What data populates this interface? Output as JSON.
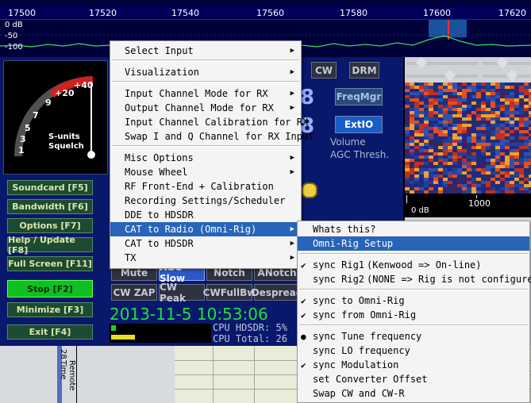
{
  "spectrum": {
    "freq_labels": [
      "17500",
      "17520",
      "17540",
      "17560",
      "17580",
      "17600",
      "17620"
    ],
    "db_labels": [
      "0 dB",
      "-50",
      "-100"
    ]
  },
  "smeter": {
    "scale_labels": [
      "+40",
      "+20",
      "9",
      "7",
      "5",
      "3",
      "1"
    ],
    "caption1": "S-units",
    "caption2": "Squelch"
  },
  "side_buttons": [
    {
      "label": "Soundcard [F5]"
    },
    {
      "label": "Bandwidth [F6]"
    },
    {
      "label": "Options [F7]"
    },
    {
      "label": "Help / Update [F8]"
    },
    {
      "label": "Full Screen [F11]"
    },
    {
      "label": "Stop [F2]"
    },
    {
      "label": "Minimize [F3]"
    },
    {
      "label": "Exit [F4]"
    }
  ],
  "mode_buttons": {
    "cw": "CW",
    "drm": "DRM"
  },
  "freqmgr": "FreqMgr",
  "extio": "ExtIO",
  "volume": "Volume",
  "agc_thresh": "AGC Thresh.",
  "row1_buttons": [
    "Mute",
    "AGC Slow",
    "Notch",
    "ANotch"
  ],
  "row2_buttons": [
    "CW ZAP",
    "CW Peak",
    "CWFullBw",
    "Despread"
  ],
  "datetime": "2013-11-5 10:53:06",
  "cpu": {
    "line1": "CPU HDSDR: 5%",
    "line2": "CPU Total: 26"
  },
  "waterfall_scale": {
    "label1": "0 dB",
    "label2": "1000"
  },
  "bottom_labels": [
    "28",
    "Remote Time"
  ],
  "main_menu": [
    {
      "label": "Select Input",
      "arrow": true
    },
    {
      "label": "Visualization",
      "arrow": true
    },
    {
      "label": "Input Channel Mode for RX",
      "arrow": true
    },
    {
      "label": "Output Channel Mode for RX",
      "arrow": true
    },
    {
      "label": "Input Channel Calibration for RX",
      "arrow": false
    },
    {
      "label": "Swap I and Q Channel for RX Input",
      "arrow": false
    },
    {
      "label": "Misc Options",
      "arrow": true
    },
    {
      "label": "Mouse Wheel",
      "arrow": true
    },
    {
      "label": "RF Front-End + Calibration",
      "arrow": false
    },
    {
      "label": "Recording Settings/Scheduler",
      "arrow": false
    },
    {
      "label": "DDE to HDSDR",
      "arrow": false
    },
    {
      "label": "CAT to Radio (Omni-Rig)",
      "arrow": true
    },
    {
      "label": "CAT to HDSDR",
      "arrow": true
    },
    {
      "label": "TX",
      "arrow": true
    }
  ],
  "sub_menu": [
    {
      "label": "Whats this?",
      "mark": ""
    },
    {
      "label": "Omni-Rig Setup",
      "mark": ""
    },
    {
      "label": "sync Rig1",
      "extra": "(Kenwood => On-line)",
      "mark": "check"
    },
    {
      "label": "sync Rig2",
      "extra": "(NONE => Rig is not configured)",
      "mark": ""
    },
    {
      "label": "sync to Omni-Rig",
      "mark": "check"
    },
    {
      "label": "sync from Omni-Rig",
      "mark": "check"
    },
    {
      "label": "sync Tune frequency",
      "mark": "dot"
    },
    {
      "label": "sync LO frequency",
      "mark": ""
    },
    {
      "label": "sync Modulation",
      "mark": "check"
    },
    {
      "label": "set Converter Offset",
      "mark": ""
    },
    {
      "label": "Swap CW and CW-R",
      "mark": ""
    }
  ],
  "colors": {
    "highlight": "#2864b8",
    "main_bg": "#08186b"
  }
}
